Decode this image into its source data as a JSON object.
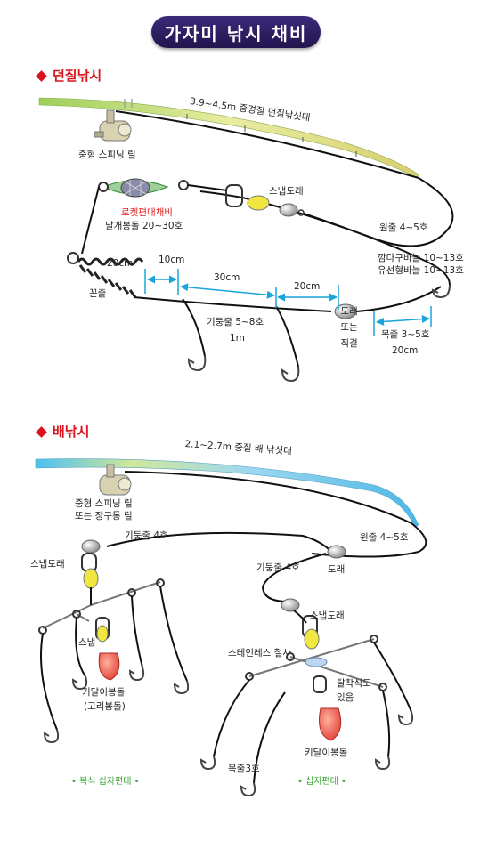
{
  "title": "가자미 낚시 채비",
  "section1": {
    "heading": "던질낚시",
    "rod": "3.9~4.5m 중경질 던질낚싯대",
    "reel": "중형 스피닝 릴",
    "snap_swivel_a": "스냅도래",
    "rocket_sinker": "로켓편대채비",
    "sinker_weight": "날개봉돌 20~30호",
    "main_line": "원줄 4~5호",
    "hook_a": "깜다구바늘 10~13호",
    "hook_b": "유선형바늘 10~13호",
    "coil_line": "꼰줄",
    "dim_20": "20cm",
    "dim_10": "10cm",
    "dim_30": "30cm",
    "dim_20b": "20cm",
    "trunk_line": "기둥줄 5~8호",
    "trunk_len": "1m",
    "swivel": "도래",
    "or": "또는",
    "direct": "직결",
    "leader": "목줄 3~5호",
    "leader_len": "20cm"
  },
  "section2": {
    "heading": "배낚시",
    "rod": "2.1~2.7m 중질 배 낚싯대",
    "reel_1": "중형 스피닝 릴",
    "reel_2": "또는 장구통 릴",
    "trunk_left": "기둥줄 4호",
    "main_line": "원줄 4~5호",
    "snap_swivel_left": "스냅도래",
    "trunk_right": "기둥줄 4호",
    "swivel_right": "도래",
    "snap_swivel_right": "스냅도래",
    "snap": "스냅",
    "stainless_wire": "스테인레스 철사",
    "detachable_1": "탈착식도",
    "detachable_2": "있음",
    "sinker_left_1": "키달이봉돌",
    "sinker_left_2": "(고리봉돌)",
    "leader": "목줄3호",
    "sinker_right": "키달이봉돌",
    "caption_left": "• 복식 쉽자편대 •",
    "caption_right": "• 십자편대 •"
  },
  "colors": {
    "accent_red": "#d8141e",
    "title_bg": "#2a1b60",
    "rod1": "#b8d86a",
    "rod2": "#5fc8ef",
    "dimension": "#1ba4d8",
    "caption": "#39a235",
    "sinker": "#e8453c"
  }
}
